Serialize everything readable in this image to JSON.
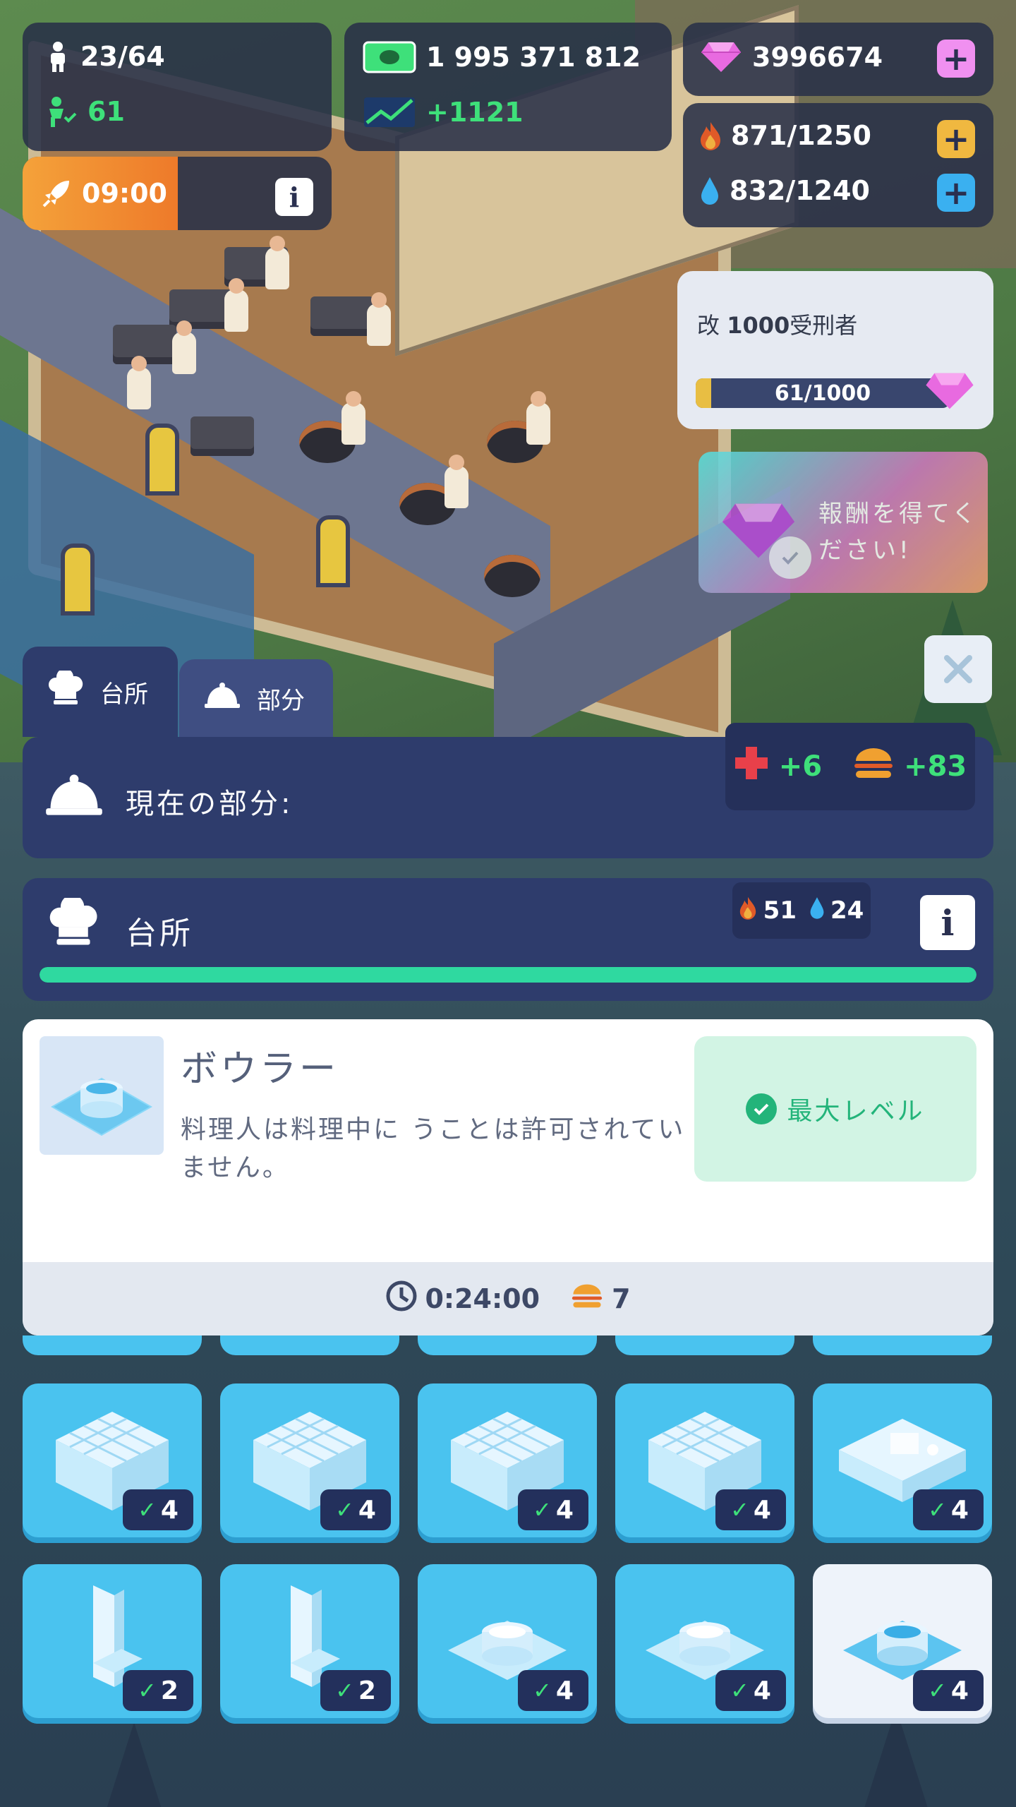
{
  "hud": {
    "prisoners": "23/64",
    "guards": "61",
    "money": "1 995 371 812",
    "income": "+1121",
    "gems": "3996674",
    "power": "871/1250",
    "water": "832/1240",
    "boost_timer": "09:00"
  },
  "quest": {
    "prefix": "改",
    "count": "1000",
    "label": "受刑者",
    "progress_text": "61/1000",
    "progress": 0.061,
    "reward_text": "報酬を得てください!"
  },
  "tabs": [
    {
      "label": "台所",
      "active": true
    },
    {
      "label": "部分",
      "active": false
    }
  ],
  "current_part": {
    "label": "現在の部分:",
    "health_bonus": "+6",
    "food_bonus": "+83"
  },
  "room": {
    "title": "台所",
    "power": "51",
    "water": "24",
    "progress": 1.0
  },
  "detail": {
    "title": "ボウラー",
    "description": "料理人は料理中に うことは許可されていません。",
    "status": "最大レベル",
    "time": "0:24:00",
    "food": "7"
  },
  "grid": {
    "row1": [
      {
        "item": "stove",
        "count": "4"
      },
      {
        "item": "stove",
        "count": "4"
      },
      {
        "item": "stove",
        "count": "4"
      },
      {
        "item": "stove",
        "count": "4"
      },
      {
        "item": "kitchen-counter",
        "count": "4"
      }
    ],
    "row2": [
      {
        "item": "sink",
        "count": "2"
      },
      {
        "item": "sink",
        "count": "2"
      },
      {
        "item": "pot",
        "count": "4"
      },
      {
        "item": "pot",
        "count": "4"
      },
      {
        "item": "pot",
        "count": "4",
        "selected": true
      }
    ]
  },
  "colors": {
    "panel": "#2e3c6c",
    "tile": "#4ac3ef",
    "accent_green": "#3ee07a",
    "gem": "#e86ae0",
    "power": "#e05a28",
    "water": "#3ab0f0"
  },
  "icons": [
    "person-icon",
    "guard-icon",
    "cash-icon",
    "trend-icon",
    "gem-icon",
    "fire-icon",
    "water-drop-icon",
    "rocket-icon",
    "chef-hat-icon",
    "bell-icon",
    "health-cross-icon",
    "burger-icon",
    "clock-icon",
    "check-icon",
    "close-icon",
    "info-icon"
  ]
}
